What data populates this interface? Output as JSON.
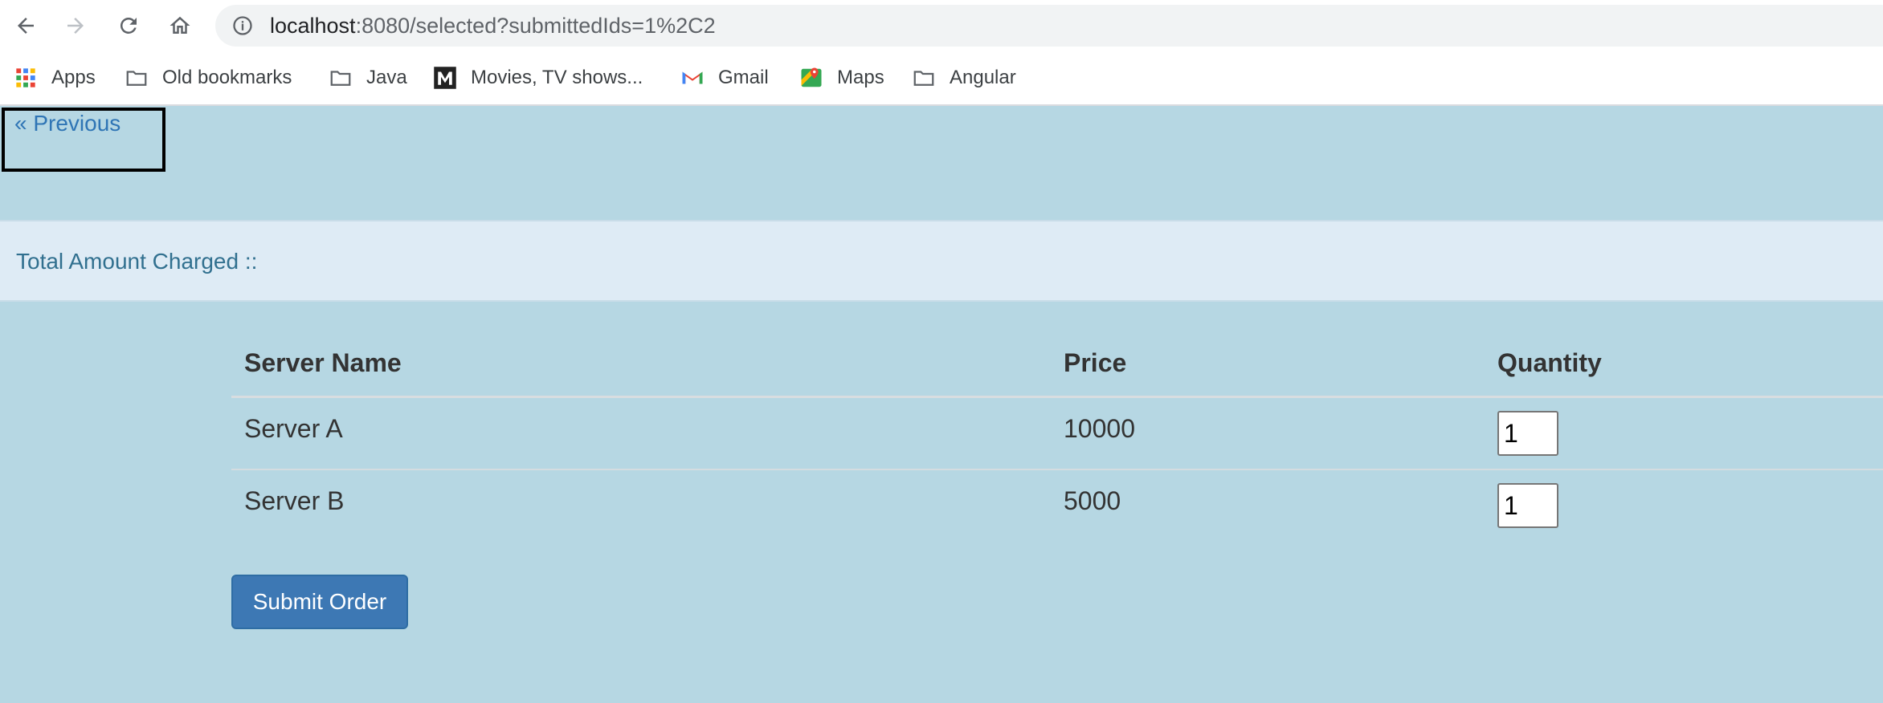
{
  "browser": {
    "url_host": "localhost",
    "url_rest": ":8080/selected?submittedIds=1%2C2"
  },
  "bookmarks": [
    {
      "label": "Apps",
      "icon": "apps-grid-icon"
    },
    {
      "label": "Old bookmarks",
      "icon": "folder-icon"
    },
    {
      "label": "Java",
      "icon": "folder-icon"
    },
    {
      "label": "Movies, TV shows...",
      "icon": "m-logo-icon"
    },
    {
      "label": "Gmail",
      "icon": "gmail-icon"
    },
    {
      "label": "Maps",
      "icon": "maps-icon"
    },
    {
      "label": "Angular",
      "icon": "folder-icon"
    }
  ],
  "page": {
    "previous_label": "« Previous",
    "total_label": "Total Amount Charged ::",
    "table": {
      "headers": [
        "Server Name",
        "Price",
        "Quantity"
      ],
      "rows": [
        {
          "name": "Server A",
          "price": "10000",
          "quantity": "1"
        },
        {
          "name": "Server B",
          "price": "5000",
          "quantity": "1"
        }
      ]
    },
    "submit_label": "Submit Order"
  },
  "colors": {
    "page_bg": "#b6d7e3",
    "total_bar_bg": "#deebf5",
    "link": "#2f75b5",
    "button_bg": "#3d78b4"
  }
}
